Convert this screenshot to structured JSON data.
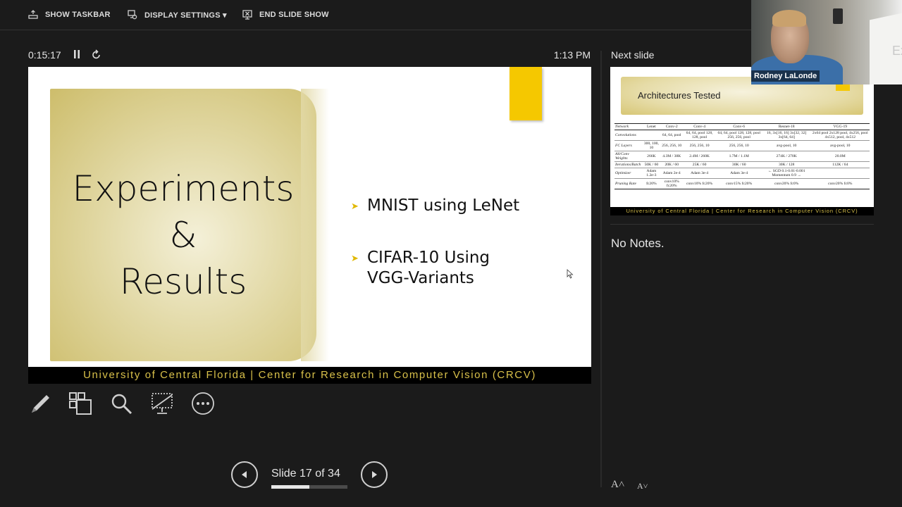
{
  "toolbar": {
    "show_taskbar": "SHOW TASKBAR",
    "display_settings": "DISPLAY SETTINGS ▾",
    "end_slide_show": "END SLIDE SHOW"
  },
  "timer": {
    "elapsed": "0:15:17",
    "clock": "1:13 PM"
  },
  "slide": {
    "title_lines": [
      "Experiments",
      "&",
      "Results"
    ],
    "bullets": [
      "MNIST using LeNet",
      "CIFAR-10 Using\nVGG-Variants"
    ],
    "footer": "University of Central Florida | Center for Research in Computer Vision (CRCV)",
    "colors": {
      "accent_yellow": "#f5c800",
      "footer_text": "#d8c04a"
    }
  },
  "navigation": {
    "slide_label": "Slide 17 of 34",
    "current": 17,
    "total": 34,
    "progress_fraction": 0.5
  },
  "next_slide": {
    "label": "Next slide",
    "title": "Architectures Tested",
    "footer": "University of Central Florida | Center for Research in Computer Vision (CRCV)",
    "table": {
      "header": [
        "Network",
        "Lenet",
        "Conv-2",
        "Conv-4",
        "Conv-6",
        "Resnet-18",
        "VGG-19"
      ],
      "rows": [
        [
          "Convolutions",
          "",
          "64, 64, pool",
          "64, 64, pool 128, 128, pool",
          "64, 64, pool 128, 128, pool 256, 256, pool",
          "16, 3x[16, 16] 3x[32, 32] 3x[64, 64]",
          "2x64 pool 2x128 pool, 4x256, pool 4x512, pool, 4x512"
        ],
        [
          "FC Layers",
          "300, 100, 10",
          "256, 256, 10",
          "256, 256, 10",
          "256, 256, 10",
          "avg-pool, 10",
          "avg-pool, 10"
        ],
        [
          "All/Conv Weights",
          "266K",
          "4.3M / 38K",
          "2.4M / 260K",
          "1.7M / 1.1M",
          "274K / 270K",
          "20.0M"
        ],
        [
          "Iterations/Batch",
          "50K / 60",
          "20K / 60",
          "25K / 60",
          "30K / 60",
          "30K / 128",
          "112K / 64"
        ],
        [
          "Optimizer",
          "Adam 1.2e-3",
          "Adam 2e-4",
          "Adam 3e-4",
          "Adam 3e-4",
          "← SGD 0.1-0.01-0.001 Momentum 0.9 →",
          ""
        ],
        [
          "Pruning Rate",
          "fc20%",
          "conv10% fc20%",
          "conv10% fc20%",
          "conv15% fc20%",
          "conv20% fc0%",
          "conv20% fc0%"
        ]
      ]
    }
  },
  "notes": {
    "text": "No Notes."
  },
  "font_controls": {
    "increase": "A˄",
    "decrease": "A˅"
  },
  "webcam": {
    "name": "Rodney LaLonde",
    "screen_text": "Ex"
  }
}
